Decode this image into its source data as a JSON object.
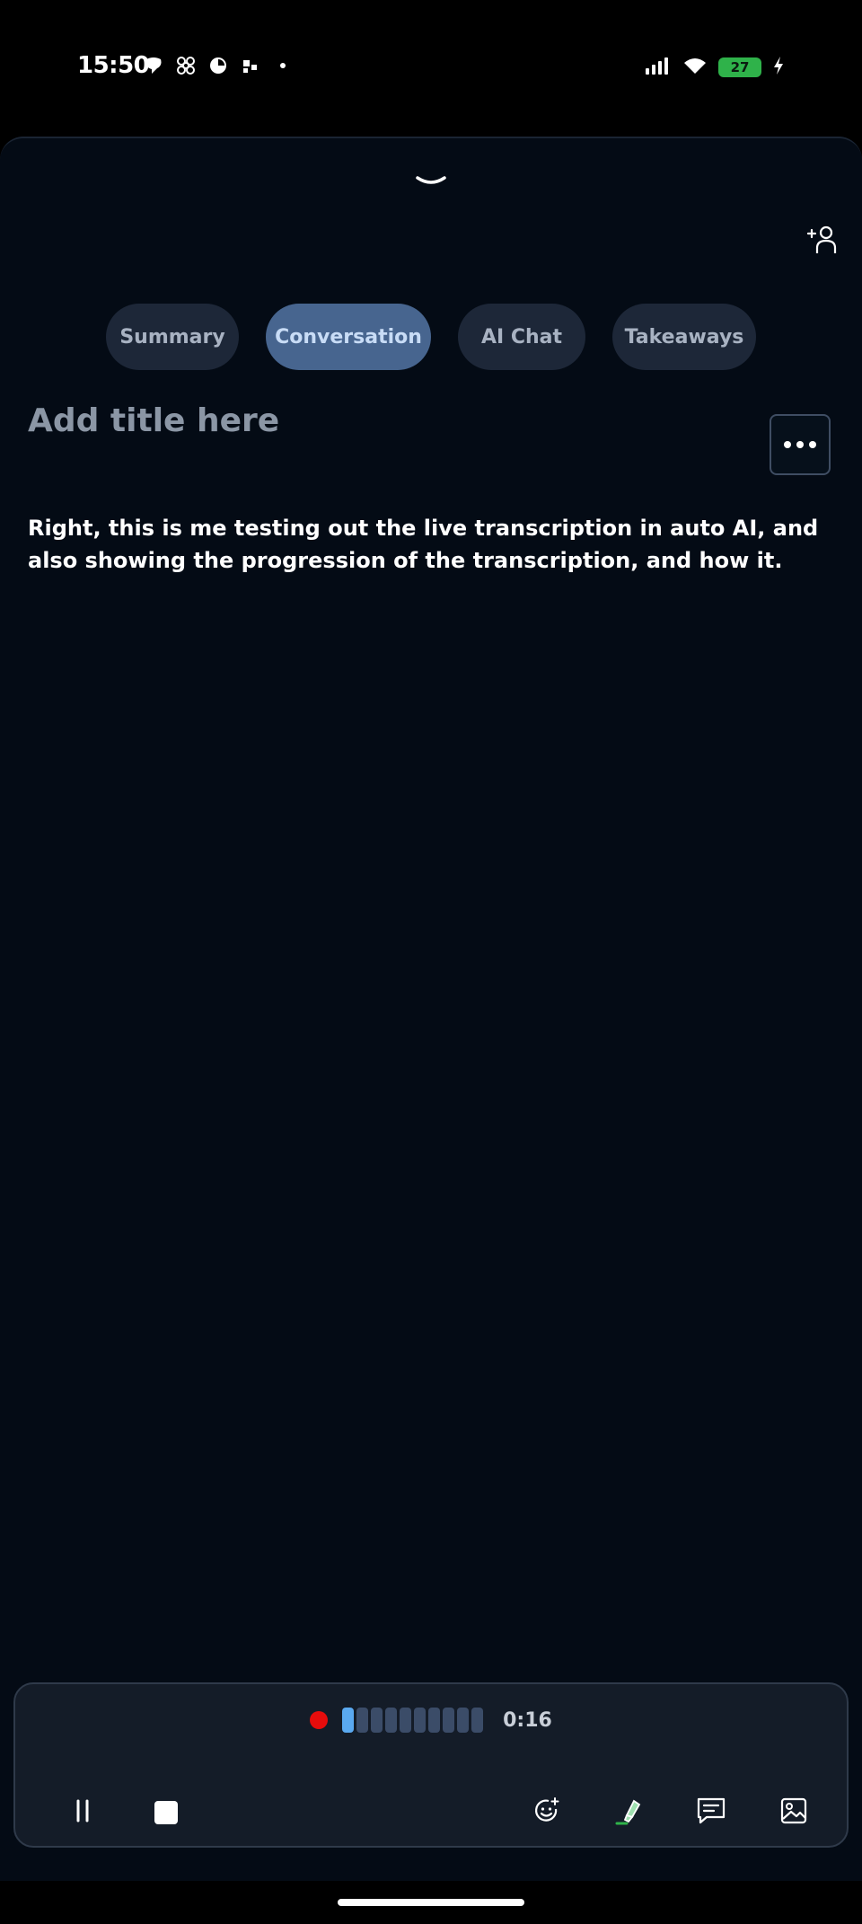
{
  "status_bar": {
    "time": "15:50",
    "battery_level": "27",
    "notification_icons": [
      "chat-bubble-icon",
      "fan-icon",
      "timer-icon",
      "app-icon",
      "more-dot-icon"
    ],
    "system_icons": [
      "signal-icon",
      "wifi-icon",
      "battery-icon",
      "charging-bolt-icon"
    ]
  },
  "header": {
    "collapse_icon": "chevron-down-icon",
    "add_person_icon": "add-person-icon"
  },
  "tabs": [
    {
      "label": "Summary",
      "active": false
    },
    {
      "label": "Conversation",
      "active": true
    },
    {
      "label": "AI Chat",
      "active": false
    },
    {
      "label": "Takeaways",
      "active": false
    }
  ],
  "note": {
    "title_placeholder": "Add title here",
    "transcript": "Right, this is me testing out the live transcription in auto AI, and also showing the progression of the transcription, and how it."
  },
  "recorder": {
    "elapsed": "0:16",
    "recording_color": "#e60c0c",
    "level_active_bars": 1,
    "level_total_bars": 10,
    "controls": [
      "pause-icon",
      "stop-icon",
      "emoji-add-icon",
      "highlighter-icon",
      "comment-icon",
      "image-icon"
    ]
  },
  "colors": {
    "background": "#040b15",
    "tab_active": "#47658f",
    "tab_inactive": "#1d2738",
    "level_active": "#5aa9f0"
  }
}
